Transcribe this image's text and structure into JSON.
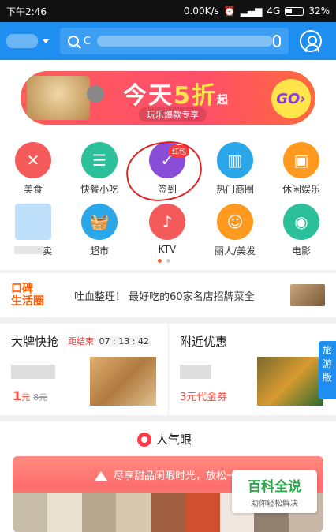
{
  "status_bar": {
    "time": "下午2:46",
    "network_speed": "0.00K/s",
    "network": "4G",
    "battery": "32%"
  },
  "search": {
    "placeholder": "C"
  },
  "banner": {
    "title_a": "今天",
    "title_b": "5折",
    "title_c": "起",
    "subtitle": "玩乐爆款专享",
    "go": "GO"
  },
  "categories": [
    {
      "label": "美食",
      "color": "#f45a5a",
      "icon": "fork-knife-icon"
    },
    {
      "label": "快餐小吃",
      "color": "#2bbf9a",
      "icon": "burger-icon"
    },
    {
      "label": "签到",
      "color": "#8a4dd8",
      "icon": "check-icon",
      "badge": "红包"
    },
    {
      "label": "热门商圈",
      "color": "#2aa7e8",
      "icon": "buildings-icon"
    },
    {
      "label": "休闲娱乐",
      "color": "#ff9a1f",
      "icon": "gamepad-icon"
    },
    {
      "label": "",
      "color": "#5aa0f0",
      "icon": "document-icon"
    },
    {
      "label": "超市",
      "color": "#2aa7e8",
      "icon": "basket-icon"
    },
    {
      "label": "KTV",
      "color": "#f45a5a",
      "icon": "microphone-icon"
    },
    {
      "label": "丽人/美发",
      "color": "#ff9a1f",
      "icon": "hair-icon"
    },
    {
      "label": "电影",
      "color": "#2bbf9a",
      "icon": "film-icon"
    }
  ],
  "category_6_suffix": "卖",
  "koubei": {
    "logo_line1": "口碑",
    "logo_line2": "生活圈",
    "text": "吐血整理！    最好吃的60家名店招牌菜全"
  },
  "deals": {
    "brand": {
      "title": "大牌快抢",
      "countdown_label": "距结束",
      "countdown_time": "07 : 13 : 42",
      "price": "1",
      "price_unit": "元",
      "old_price": "8元"
    },
    "nearby": {
      "title": "附近优惠",
      "coupon": "3元代金券"
    }
  },
  "side_tab": {
    "line1": "旅",
    "line2": "游",
    "line3": "版"
  },
  "popular": {
    "title": "人气眼",
    "banner_text": "尽享甜品闲暇时光，放松一下"
  },
  "watermark": {
    "title": "百科全说",
    "subtitle": "助你轻松解决"
  }
}
